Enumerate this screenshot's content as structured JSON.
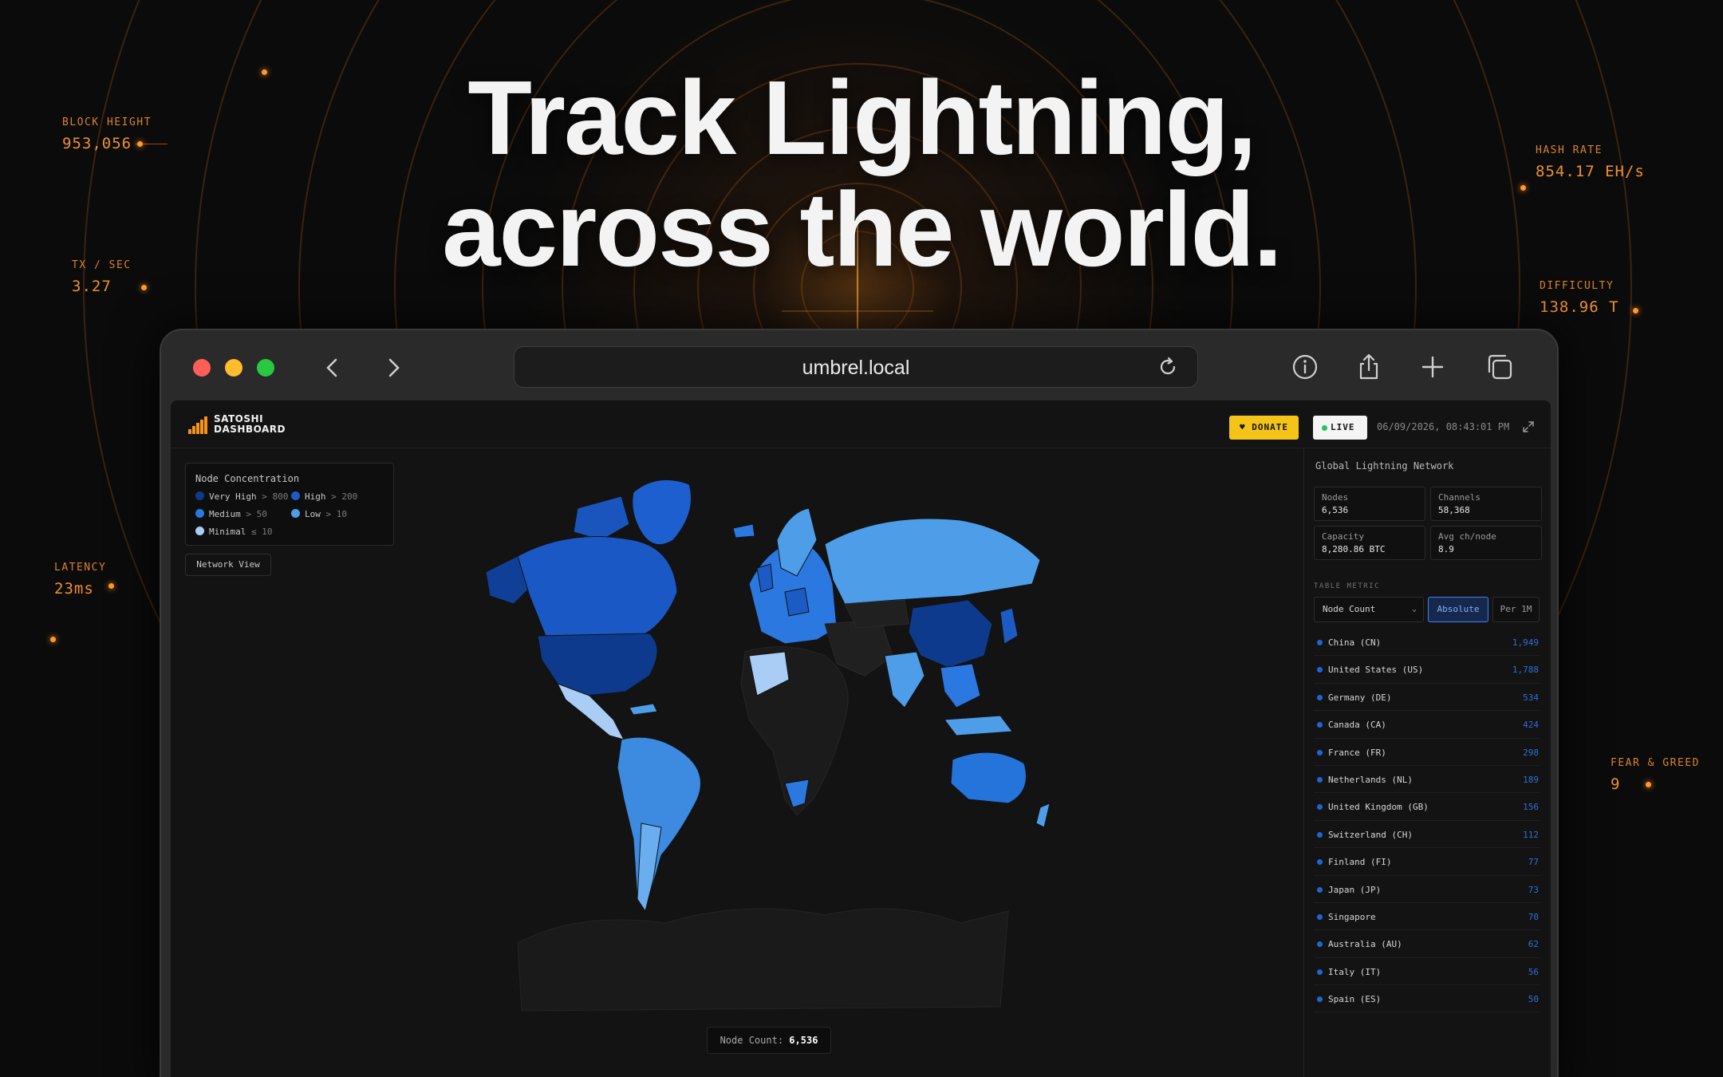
{
  "headline": {
    "line1": "Track Lightning,",
    "line2": "across the world."
  },
  "stats": {
    "block_height": {
      "label": "BLOCK HEIGHT",
      "value": "953,056"
    },
    "tx_sec": {
      "label": "TX / SEC",
      "value": "3.27"
    },
    "latency": {
      "label": "LATENCY",
      "value": "23ms"
    },
    "hash_rate": {
      "label": "HASH RATE",
      "value": "854.17 EH/s"
    },
    "difficulty": {
      "label": "DIFFICULTY",
      "value": "138.96 T"
    },
    "fear_greed": {
      "label": "FEAR & GREED",
      "value": "9"
    }
  },
  "browser": {
    "url": "umbrel.local"
  },
  "app": {
    "logo_line1": "SATOSHI",
    "logo_line2": "DASHBOARD",
    "donate_label": "♥ DONATE",
    "live_label": "LIVE",
    "datetime": "06/09/2026, 08:43:01 PM",
    "legend": {
      "title": "Node Concentration",
      "items": [
        {
          "label": "Very High",
          "threshold": "> 800",
          "color": "#0d3a8c"
        },
        {
          "label": "High",
          "threshold": "> 200",
          "color": "#1c5bc4"
        },
        {
          "label": "Medium",
          "threshold": "> 50",
          "color": "#2b78e0"
        },
        {
          "label": "Low",
          "threshold": "> 10",
          "color": "#4d9de8"
        },
        {
          "label": "Minimal",
          "threshold": "≤ 10",
          "color": "#a9cdf4"
        }
      ]
    },
    "network_view_label": "Network View",
    "node_count_label": "Node Count:",
    "node_count_value": "6,536",
    "sidebar": {
      "title": "Global Lightning Network",
      "cards": [
        {
          "label": "Nodes",
          "value": "6,536"
        },
        {
          "label": "Channels",
          "value": "58,368"
        },
        {
          "label": "Capacity",
          "value": "8,280.86 BTC"
        },
        {
          "label": "Avg ch/node",
          "value": "8.9"
        }
      ],
      "table_metric_label": "TABLE METRIC",
      "metric_select": "Node Count",
      "seg_absolute": "Absolute",
      "seg_per": "Per 1M",
      "countries": [
        {
          "name": "China (CN)",
          "value": "1,949"
        },
        {
          "name": "United States (US)",
          "value": "1,788"
        },
        {
          "name": "Germany (DE)",
          "value": "534"
        },
        {
          "name": "Canada (CA)",
          "value": "424"
        },
        {
          "name": "France (FR)",
          "value": "298"
        },
        {
          "name": "Netherlands (NL)",
          "value": "189"
        },
        {
          "name": "United Kingdom (GB)",
          "value": "156"
        },
        {
          "name": "Switzerland (CH)",
          "value": "112"
        },
        {
          "name": "Finland (FI)",
          "value": "77"
        },
        {
          "name": "Japan (JP)",
          "value": "73"
        },
        {
          "name": "Singapore",
          "value": "70"
        },
        {
          "name": "Australia (AU)",
          "value": "62"
        },
        {
          "name": "Italy (IT)",
          "value": "56"
        },
        {
          "name": "Spain (ES)",
          "value": "50"
        }
      ]
    }
  }
}
